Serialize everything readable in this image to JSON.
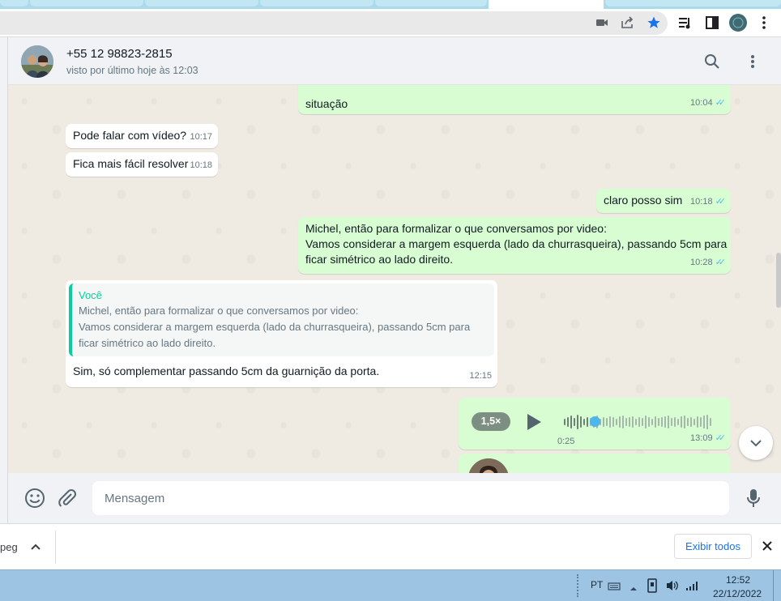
{
  "browser": {
    "icons": [
      "camera-off-icon",
      "share-icon",
      "star-icon",
      "media-icon",
      "sidepanel-icon",
      "profile-icon",
      "kebab-menu-icon"
    ],
    "accent": "#1a73e8"
  },
  "chat": {
    "contact_name": "+55 12 98823-2815",
    "status": "visto por último hoje às 12:03",
    "icons": [
      "search-icon",
      "menu-icon"
    ]
  },
  "messages": [
    {
      "dir": "out",
      "text": "situação",
      "time": "10:04",
      "ticks": "✓✓"
    },
    {
      "dir": "in",
      "text": "Pode falar com vídeo?",
      "time": "10:17"
    },
    {
      "dir": "in",
      "text": "Fica mais fácil resolver",
      "time": "10:18"
    },
    {
      "dir": "out",
      "text": "claro posso sim",
      "time": "10:18",
      "ticks": "✓✓"
    },
    {
      "dir": "out",
      "lines": [
        "Michel, então para formalizar o que conversamos por video:",
        "Vamos considerar a margem esquerda (lado da churrasqueira), passando 5cm para",
        "ficar simétrico ao lado direito."
      ],
      "time": "10:28",
      "ticks": "✓✓"
    },
    {
      "dir": "in",
      "quote": {
        "author": "Você",
        "lines": [
          "Michel, então para formalizar o que conversamos por video:",
          "Vamos considerar a margem esquerda (lado da churrasqueira), passando 5cm para",
          "ficar simétrico ao lado direito."
        ]
      },
      "text": "Sim, só complementar passando 5cm da guarnição da porta.",
      "time": "12:15"
    },
    {
      "dir": "out",
      "type": "audio",
      "speed": "1,5×",
      "duration": "0:25",
      "progress": 0.18,
      "time": "13:09",
      "ticks": "✓✓"
    }
  ],
  "composer": {
    "placeholder": "Mensagem",
    "icons": [
      "emoji-icon",
      "attach-icon",
      "mic-icon"
    ]
  },
  "downloads": {
    "file_name": "peg",
    "show_all": "Exibir todos"
  },
  "taskbar": {
    "language": "PT",
    "time": "12:52",
    "date": "22/12/2022"
  }
}
